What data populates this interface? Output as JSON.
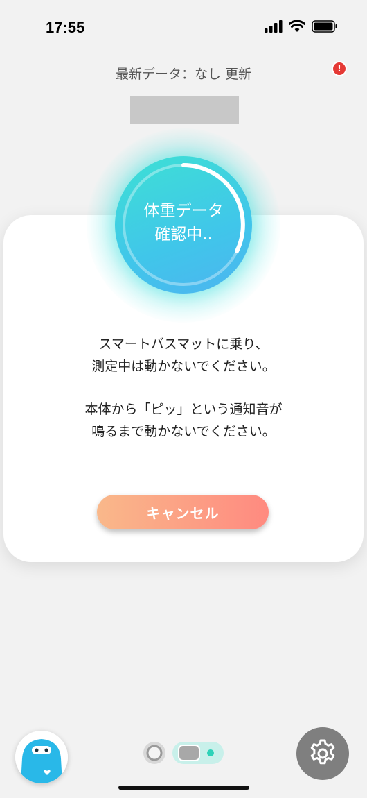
{
  "status_bar": {
    "time": "17:55"
  },
  "header": {
    "latest_data": "最新データ：なし 更新",
    "alert_badge": "!"
  },
  "measure": {
    "line1": "体重データ",
    "line2": "確認中.."
  },
  "instructions": {
    "line1": "スマートバスマットに乗り、",
    "line2": "測定中は動かないでください。",
    "line3": "本体から「ピッ」という通知音が",
    "line4": "鳴るまで動かないでください。"
  },
  "buttons": {
    "cancel": "キャンセル"
  },
  "colors": {
    "accent_teal": "#3ee0d4",
    "accent_blue": "#4db4f0",
    "cancel_start": "#f9b88a",
    "cancel_end": "#ff8a80",
    "alert_red": "#e53935"
  },
  "icons": {
    "signal": "cellular-signal-icon",
    "wifi": "wifi-icon",
    "battery": "battery-icon",
    "settings": "gear-icon",
    "avatar": "character-avatar"
  }
}
